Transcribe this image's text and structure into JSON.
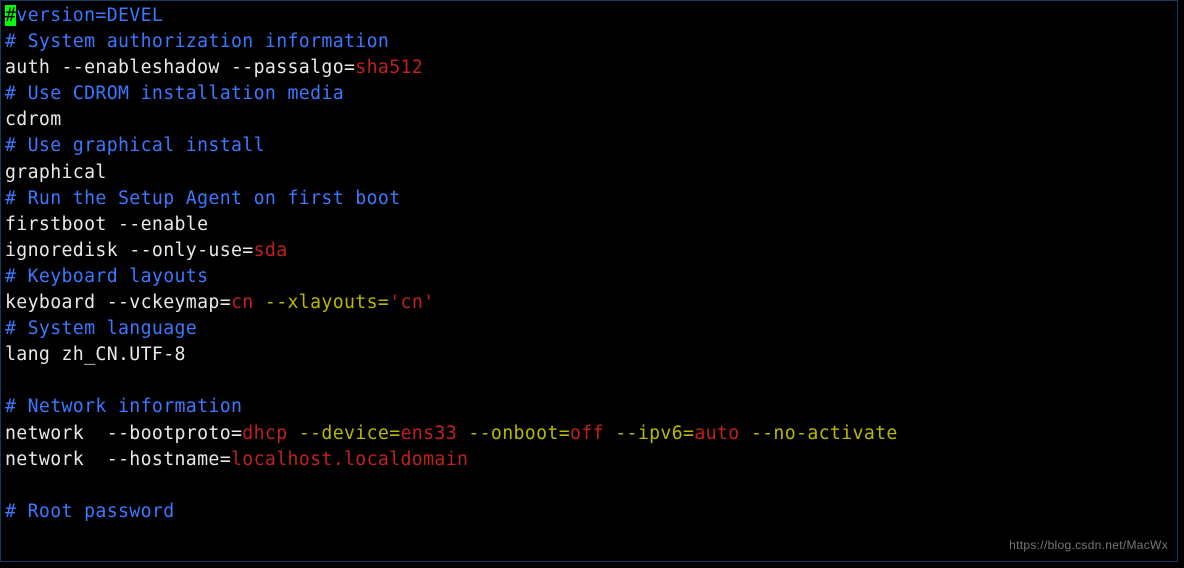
{
  "tokens": [
    [
      "cursor",
      "#"
    ],
    [
      "blue",
      "version=DEVEL"
    ],
    [
      "nl"
    ],
    [
      "blue",
      "# System authorization information"
    ],
    [
      "nl"
    ],
    [
      "white",
      "auth --enableshadow --passalgo="
    ],
    [
      "red",
      "sha512"
    ],
    [
      "nl"
    ],
    [
      "blue",
      "# Use CDROM installation media"
    ],
    [
      "nl"
    ],
    [
      "white",
      "cdrom"
    ],
    [
      "nl"
    ],
    [
      "blue",
      "# Use graphical install"
    ],
    [
      "nl"
    ],
    [
      "white",
      "graphical"
    ],
    [
      "nl"
    ],
    [
      "blue",
      "# Run the Setup Agent on first boot"
    ],
    [
      "nl"
    ],
    [
      "white",
      "firstboot --enable"
    ],
    [
      "nl"
    ],
    [
      "white",
      "ignoredisk --only-use="
    ],
    [
      "red",
      "sda"
    ],
    [
      "nl"
    ],
    [
      "blue",
      "# Keyboard layouts"
    ],
    [
      "nl"
    ],
    [
      "white",
      "keyboard --vckeymap="
    ],
    [
      "red",
      "cn "
    ],
    [
      "yellow",
      "--xlayouts="
    ],
    [
      "red",
      "'cn'"
    ],
    [
      "nl"
    ],
    [
      "blue",
      "# System language"
    ],
    [
      "nl"
    ],
    [
      "white",
      "lang zh_CN.UTF-8"
    ],
    [
      "nl"
    ],
    [
      "nl"
    ],
    [
      "blue",
      "# Network information"
    ],
    [
      "nl"
    ],
    [
      "white",
      "network  --bootproto="
    ],
    [
      "red",
      "dhcp "
    ],
    [
      "yellow",
      "--device="
    ],
    [
      "red",
      "ens33 "
    ],
    [
      "yellow",
      "--onboot="
    ],
    [
      "red",
      "off "
    ],
    [
      "yellow",
      "--ipv6="
    ],
    [
      "red",
      "auto "
    ],
    [
      "yellow",
      "--no-activate"
    ],
    [
      "nl"
    ],
    [
      "white",
      "network  --hostname="
    ],
    [
      "red",
      "localhost.localdomain"
    ],
    [
      "nl"
    ],
    [
      "nl"
    ],
    [
      "blue",
      "# Root password"
    ]
  ],
  "watermark": "https://blog.csdn.net/MacWx"
}
